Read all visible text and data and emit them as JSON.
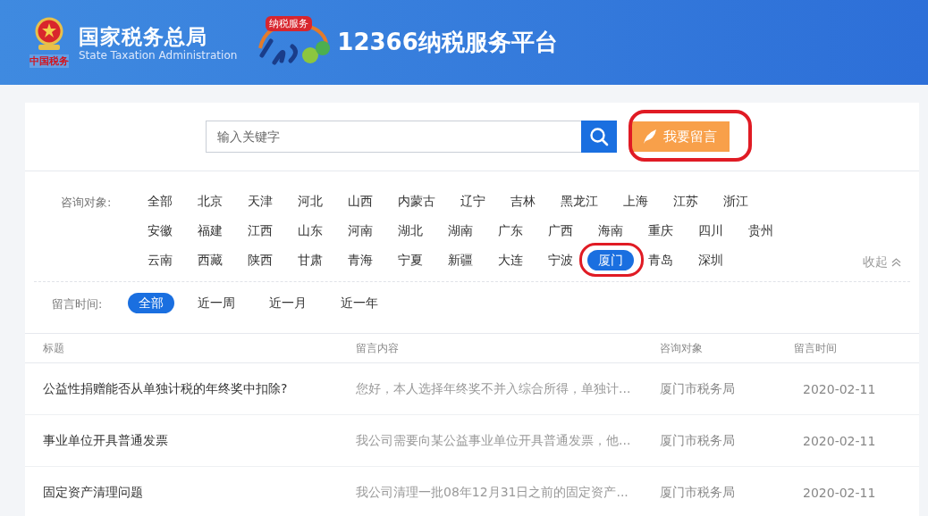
{
  "header": {
    "emblem_caption": "中国税务",
    "title": "国家税务总局",
    "subtitle": "State Taxation Administration",
    "hotline_badge": "纳税服务",
    "platform_title": "12366纳税服务平台"
  },
  "search": {
    "placeholder": "输入关键字",
    "post_button": "我要留言"
  },
  "filters": {
    "target_label": "咨询对象:",
    "targets": [
      {
        "label": "全部",
        "selected": false
      },
      {
        "label": "北京",
        "selected": false
      },
      {
        "label": "天津",
        "selected": false
      },
      {
        "label": "河北",
        "selected": false
      },
      {
        "label": "山西",
        "selected": false
      },
      {
        "label": "内蒙古",
        "selected": false
      },
      {
        "label": "辽宁",
        "selected": false
      },
      {
        "label": "吉林",
        "selected": false
      },
      {
        "label": "黑龙江",
        "selected": false
      },
      {
        "label": "上海",
        "selected": false
      },
      {
        "label": "江苏",
        "selected": false
      },
      {
        "label": "浙江",
        "selected": false
      },
      {
        "label": "安徽",
        "selected": false
      },
      {
        "label": "福建",
        "selected": false
      },
      {
        "label": "江西",
        "selected": false
      },
      {
        "label": "山东",
        "selected": false
      },
      {
        "label": "河南",
        "selected": false
      },
      {
        "label": "湖北",
        "selected": false
      },
      {
        "label": "湖南",
        "selected": false
      },
      {
        "label": "广东",
        "selected": false
      },
      {
        "label": "广西",
        "selected": false
      },
      {
        "label": "海南",
        "selected": false
      },
      {
        "label": "重庆",
        "selected": false
      },
      {
        "label": "四川",
        "selected": false
      },
      {
        "label": "贵州",
        "selected": false
      },
      {
        "label": "云南",
        "selected": false
      },
      {
        "label": "西藏",
        "selected": false
      },
      {
        "label": "陕西",
        "selected": false
      },
      {
        "label": "甘肃",
        "selected": false
      },
      {
        "label": "青海",
        "selected": false
      },
      {
        "label": "宁夏",
        "selected": false
      },
      {
        "label": "新疆",
        "selected": false
      },
      {
        "label": "大连",
        "selected": false
      },
      {
        "label": "宁波",
        "selected": false
      },
      {
        "label": "厦门",
        "selected": true
      },
      {
        "label": "青岛",
        "selected": false
      },
      {
        "label": "深圳",
        "selected": false
      }
    ],
    "collapse": "收起",
    "time_label": "留言时间:",
    "times": [
      {
        "label": "全部",
        "selected": true
      },
      {
        "label": "近一周",
        "selected": false
      },
      {
        "label": "近一月",
        "selected": false
      },
      {
        "label": "近一年",
        "selected": false
      }
    ]
  },
  "table": {
    "columns": [
      "标题",
      "留言内容",
      "咨询对象",
      "留言时间"
    ],
    "rows": [
      [
        "公益性捐赠能否从单独计税的年终奖中扣除?",
        "您好，本人选择年终奖不并入综合所得，单独计...",
        "厦门市税务局",
        "2020-02-11"
      ],
      [
        "事业单位开具普通发票",
        "我公司需要向某公益事业单位开具普通发票，他...",
        "厦门市税务局",
        "2020-02-11"
      ],
      [
        "固定资产清理问题",
        "我公司清理一批08年12月31日之前的固定资产...",
        "厦门市税务局",
        "2020-02-11"
      ]
    ]
  }
}
